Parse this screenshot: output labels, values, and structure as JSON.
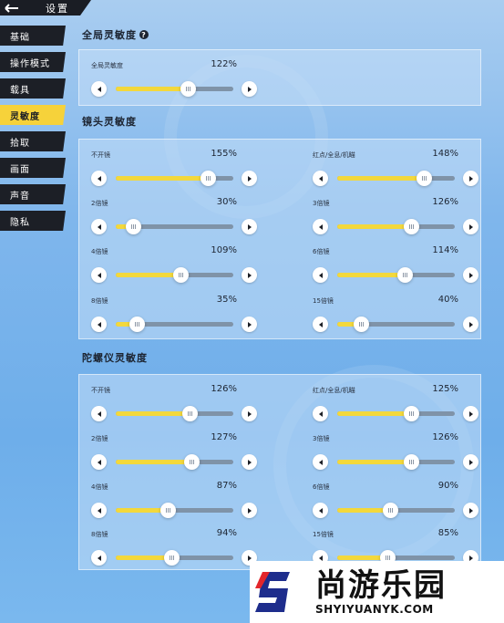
{
  "header": {
    "title": "设置"
  },
  "sidebar": {
    "items": [
      {
        "label": "基础"
      },
      {
        "label": "操作模式"
      },
      {
        "label": "载具"
      },
      {
        "label": "灵敏度",
        "active": true
      },
      {
        "label": "拾取"
      },
      {
        "label": "画面"
      },
      {
        "label": "声音"
      },
      {
        "label": "隐私"
      }
    ]
  },
  "global": {
    "title": "全局灵敏度",
    "sliders": [
      {
        "label": "全局灵敏度",
        "value": "122%",
        "level": 0.61
      }
    ]
  },
  "camera": {
    "title": "镜头灵敏度",
    "sliders": [
      {
        "label": "不开镜",
        "value": "155%",
        "level": 0.78
      },
      {
        "label": "红点/全息/机瞄",
        "value": "148%",
        "level": 0.74
      },
      {
        "label": "2倍镜",
        "value": "30%",
        "level": 0.15
      },
      {
        "label": "3倍镜",
        "value": "126%",
        "level": 0.63
      },
      {
        "label": "4倍镜",
        "value": "109%",
        "level": 0.55
      },
      {
        "label": "6倍镜",
        "value": "114%",
        "level": 0.57
      },
      {
        "label": "8倍镜",
        "value": "35%",
        "level": 0.18
      },
      {
        "label": "15倍镜",
        "value": "40%",
        "level": 0.2
      }
    ]
  },
  "gyro": {
    "title": "陀螺仪灵敏度",
    "sliders": [
      {
        "label": "不开镜",
        "value": "126%",
        "level": 0.63
      },
      {
        "label": "红点/全息/机瞄",
        "value": "125%",
        "level": 0.63
      },
      {
        "label": "2倍镜",
        "value": "127%",
        "level": 0.64
      },
      {
        "label": "3倍镜",
        "value": "126%",
        "level": 0.63
      },
      {
        "label": "4倍镜",
        "value": "87%",
        "level": 0.44
      },
      {
        "label": "6倍镜",
        "value": "90%",
        "level": 0.45
      },
      {
        "label": "8倍镜",
        "value": "94%",
        "level": 0.47
      },
      {
        "label": "15倍镜",
        "value": "85%",
        "level": 0.43
      }
    ]
  },
  "watermark": {
    "text_cn": "尚游乐园",
    "text_en": "SHYIYUANYK.COM"
  },
  "colors": {
    "accent": "#f6d23a",
    "sidebar_bg": "#1c1f26",
    "track": "#7f93a8"
  }
}
